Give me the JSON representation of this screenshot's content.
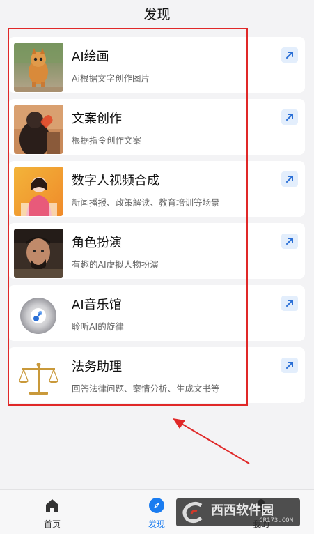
{
  "header": {
    "title": "发现"
  },
  "features": [
    {
      "title": "AI绘画",
      "desc": "Ai根据文字创作图片",
      "thumb": "cat-running-photo",
      "action_icon": "arrow-up-right-icon"
    },
    {
      "title": "文案创作",
      "desc": "根据指令创作文案",
      "thumb": "woman-heart-gesture-photo",
      "action_icon": "arrow-up-right-icon"
    },
    {
      "title": "数字人视频合成",
      "desc": "新闻播报、政策解读、教育培训等场景",
      "thumb": "digital-anchor-photo",
      "action_icon": "arrow-up-right-icon"
    },
    {
      "title": "角色扮演",
      "desc": "有趣的AI虚拟人物扮演",
      "thumb": "historical-figure-photo",
      "action_icon": "arrow-up-right-icon"
    },
    {
      "title": "AI音乐馆",
      "desc": "聆听AI的旋律",
      "thumb": "music-disc-icon",
      "action_icon": "arrow-up-right-icon"
    },
    {
      "title": "法务助理",
      "desc": "回答法律问题、案情分析、生成文书等",
      "thumb": "scales-of-justice-icon",
      "action_icon": "arrow-up-right-icon"
    }
  ],
  "bottom_nav": [
    {
      "label": "首页",
      "icon": "home-icon",
      "active": false
    },
    {
      "label": "发现",
      "icon": "compass-icon",
      "active": true
    },
    {
      "label": "我的",
      "icon": "user-icon",
      "active": false
    }
  ],
  "watermark": {
    "text": "西西软件园",
    "url": "CR173.COM"
  },
  "colors": {
    "accent": "#1a7cf0",
    "annotation": "#e02828",
    "arrow_bg": "#e3eefc"
  }
}
